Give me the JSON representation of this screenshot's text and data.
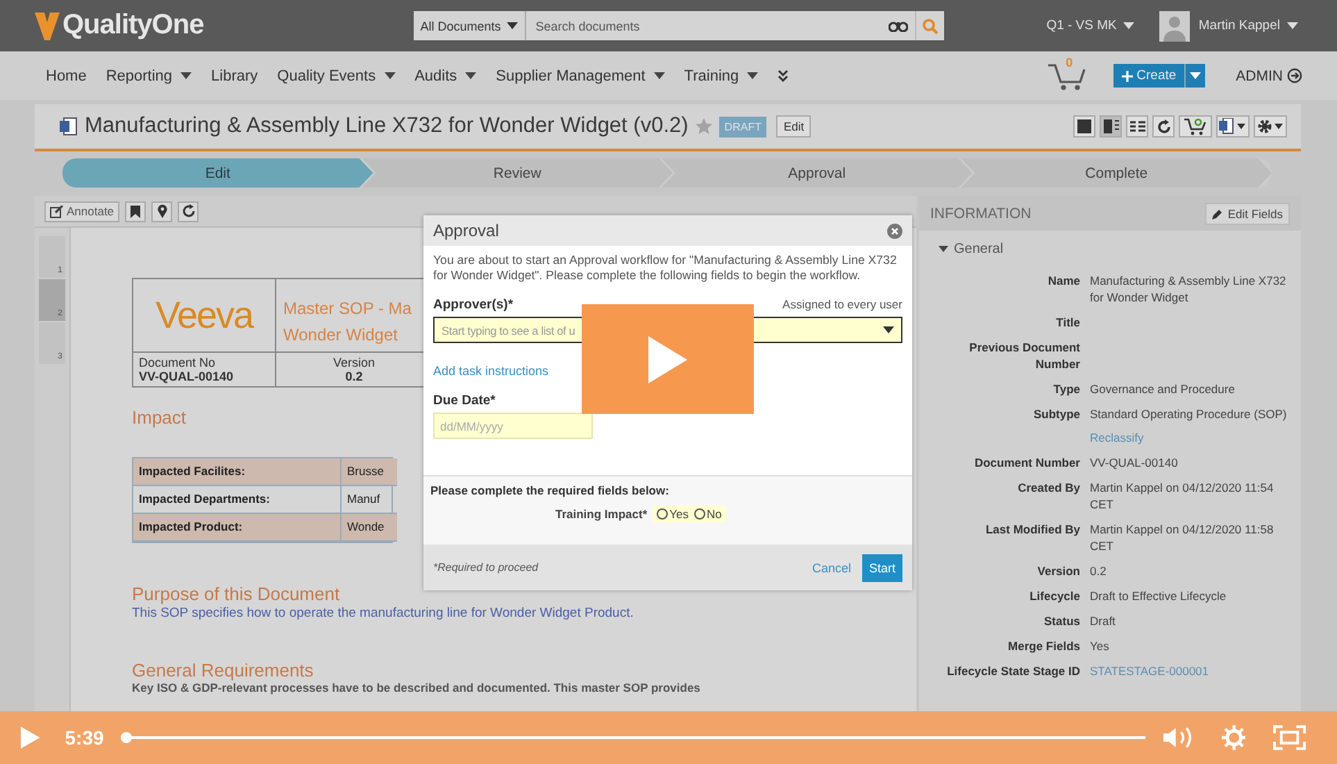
{
  "app": {
    "logo": "QualityOne",
    "search": {
      "scope": "All Documents",
      "placeholder": "Search documents"
    },
    "vault": "Q1 - VS MK",
    "user": "Martin Kappel"
  },
  "nav": {
    "items": [
      {
        "label": "Home",
        "dropdown": false
      },
      {
        "label": "Reporting",
        "dropdown": true
      },
      {
        "label": "Library",
        "dropdown": false
      },
      {
        "label": "Quality Events",
        "dropdown": true
      },
      {
        "label": "Audits",
        "dropdown": true
      },
      {
        "label": "Supplier Management",
        "dropdown": true
      },
      {
        "label": "Training",
        "dropdown": true
      }
    ],
    "cart_count": "0",
    "create": "Create",
    "admin": "ADMIN"
  },
  "document": {
    "title": "Manufacturing & Assembly Line X732 for Wonder Widget (v0.2)",
    "status": "DRAFT",
    "edit": "Edit"
  },
  "steps": [
    {
      "label": "Edit",
      "selected": true
    },
    {
      "label": "Review",
      "selected": false
    },
    {
      "label": "Approval",
      "selected": false
    },
    {
      "label": "Complete",
      "selected": false
    }
  ],
  "viewer": {
    "annotate": "Annotate",
    "pages": [
      {
        "number": "1",
        "selected": false
      },
      {
        "number": "2",
        "selected": true
      },
      {
        "number": "3",
        "selected": false
      }
    ]
  },
  "page": {
    "logo": "Veeva",
    "title_lines": [
      "Master SOP  - Ma",
      "Wonder Widget"
    ],
    "doc_no_label": "Document No",
    "doc_no": "VV-QUAL-00140",
    "version_label": "Version",
    "version": "0.2",
    "impact_heading": "Impact",
    "impact_rows": [
      {
        "label": "Impacted Facilites:",
        "value": "Brusse"
      },
      {
        "label": "Impacted Departments:",
        "value": "Manuf"
      },
      {
        "label": "Impacted Product:",
        "value": "Wonde"
      }
    ],
    "purpose_heading": "Purpose of this Document",
    "purpose_text": "This SOP specifies how to operate the manufacturing line for Wonder Widget Product.",
    "requirements_heading": "General Requirements",
    "requirements_text": "Key ISO & GDP-relevant processes have to be described and documented. This master SOP provides"
  },
  "modal": {
    "title": "Approval",
    "intro": "You are about to start an Approval workflow for \"Manufacturing & Assembly Line X732 for Wonder Widget\". Please complete the following fields to begin the workflow.",
    "approver_label": "Approver(s)*",
    "assigned": "Assigned to every user",
    "approver_placeholder": "Start typing to see a list of u",
    "add_instructions": "Add task instructions",
    "due_label": "Due Date*",
    "due_placeholder": "dd/MM/yyyy",
    "required_note": "Please complete the required fields below:",
    "training_label": "Training Impact*",
    "options": [
      {
        "label": "Yes",
        "selected": false
      },
      {
        "label": "No",
        "selected": false
      }
    ],
    "footer_note": "*Required to proceed",
    "cancel": "Cancel",
    "start": "Start"
  },
  "info": {
    "header": "INFORMATION",
    "edit_fields": "Edit Fields",
    "section": {
      "label": "General",
      "expanded": true
    },
    "fields": [
      {
        "label": "Name",
        "value": "Manufacturing & Assembly Line X732 for Wonder Widget",
        "link": false
      },
      {
        "label": "Title"
      },
      {
        "label": "Previous Document Number"
      },
      {
        "label": "Type",
        "value": "Governance and Procedure",
        "link": false
      },
      {
        "label": "Subtype",
        "value": "Standard Operating Procedure (SOP)",
        "action": "Reclassify",
        "link": false
      },
      {
        "label": "Document Number",
        "value": "VV-QUAL-00140",
        "link": false
      },
      {
        "label": "Created By",
        "value": "Martin Kappel on 04/12/2020 11:54 CET",
        "link": false
      },
      {
        "label": "Last Modified By",
        "value": "Martin Kappel on 04/12/2020 11:58 CET",
        "link": false
      },
      {
        "label": "Version",
        "value": "0.2",
        "link": false
      },
      {
        "label": "Lifecycle",
        "value": "Draft to Effective Lifecycle",
        "link": false
      },
      {
        "label": "Status",
        "value": "Draft",
        "link": false
      },
      {
        "label": "Merge Fields",
        "value": "Yes",
        "link": false
      },
      {
        "label": "Lifecycle State Stage ID",
        "value": "STATESTAGE-000001",
        "link": true
      }
    ]
  },
  "player": {
    "time": "5:39",
    "level": 0
  }
}
